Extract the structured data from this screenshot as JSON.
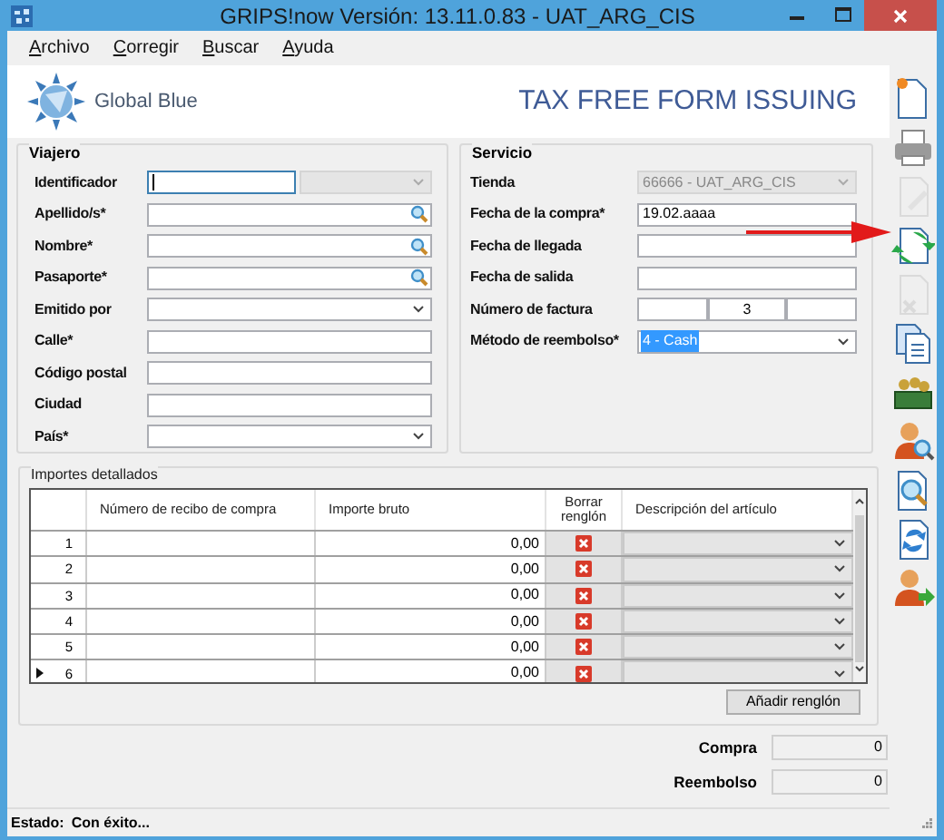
{
  "window": {
    "title": "GRIPS!now Versión: 13.11.0.83 - UAT_ARG_CIS"
  },
  "menu": [
    {
      "label": "Archivo"
    },
    {
      "label": "Corregir"
    },
    {
      "label": "Buscar"
    },
    {
      "label": "Ayuda"
    }
  ],
  "header": {
    "logo_text": "Global Blue",
    "title": "TAX FREE FORM ISSUING"
  },
  "toolbar": [
    {
      "kind": "new",
      "disabled": false
    },
    {
      "kind": "print",
      "disabled": false
    },
    {
      "kind": "edit",
      "disabled": true
    },
    {
      "kind": "swap",
      "disabled": false
    },
    {
      "kind": "delete",
      "disabled": true
    },
    {
      "kind": "copy",
      "disabled": false
    },
    {
      "kind": "money",
      "disabled": false
    },
    {
      "kind": "user-search",
      "disabled": false
    },
    {
      "kind": "doc-search",
      "disabled": false
    },
    {
      "kind": "refresh",
      "disabled": false
    },
    {
      "kind": "user-add",
      "disabled": false
    }
  ],
  "traveler": {
    "title": "Viajero",
    "fields": [
      {
        "label": "Identificador",
        "kind": "id",
        "focused": true
      },
      {
        "label": "Apellido/s*",
        "kind": "search"
      },
      {
        "label": "Nombre*",
        "kind": "search"
      },
      {
        "label": "Pasaporte*",
        "kind": "search"
      },
      {
        "label": "Emitido por",
        "kind": "combo",
        "disabled": false
      },
      {
        "label": "Calle*",
        "kind": "text"
      },
      {
        "label": "Código postal",
        "kind": "text"
      },
      {
        "label": "Ciudad",
        "kind": "text"
      },
      {
        "label": "País*",
        "kind": "combo",
        "disabled": false
      }
    ]
  },
  "service": {
    "title": "Servicio",
    "fields": [
      {
        "label": "Tienda",
        "kind": "combo",
        "value": "66666 - UAT_ARG_CIS",
        "disabled": true,
        "highlighted": false
      },
      {
        "label": "Fecha de la compra*",
        "kind": "text",
        "value": "19.02.aaaa"
      },
      {
        "label": "Fecha de llegada",
        "kind": "text"
      },
      {
        "label": "Fecha de salida",
        "kind": "text"
      },
      {
        "label": "Número de factura",
        "kind": "triple",
        "value": "3"
      },
      {
        "label": "Método de reembolso*",
        "kind": "combo",
        "value": "4 - Cash",
        "disabled": false,
        "highlighted": true
      }
    ]
  },
  "details": {
    "title": "Importes detallados",
    "columns": [
      "Número de recibo de compra",
      "Importe bruto",
      "Borrar renglón",
      "Descripción del artículo"
    ],
    "rows": [
      {
        "number": "1",
        "amount": "0,00",
        "current": false
      },
      {
        "number": "2",
        "amount": "0,00",
        "current": false
      },
      {
        "number": "3",
        "amount": "0,00",
        "current": false
      },
      {
        "number": "4",
        "amount": "0,00",
        "current": false
      },
      {
        "number": "5",
        "amount": "0,00",
        "current": false
      },
      {
        "number": "6",
        "amount": "0,00",
        "current": true
      }
    ],
    "add_button": "Añadir renglón"
  },
  "totals": [
    {
      "label": "Compra",
      "value": "0"
    },
    {
      "label": "Reembolso",
      "value": "0"
    }
  ],
  "status_bar": {
    "label": "Estado:",
    "text": "Con éxito..."
  }
}
